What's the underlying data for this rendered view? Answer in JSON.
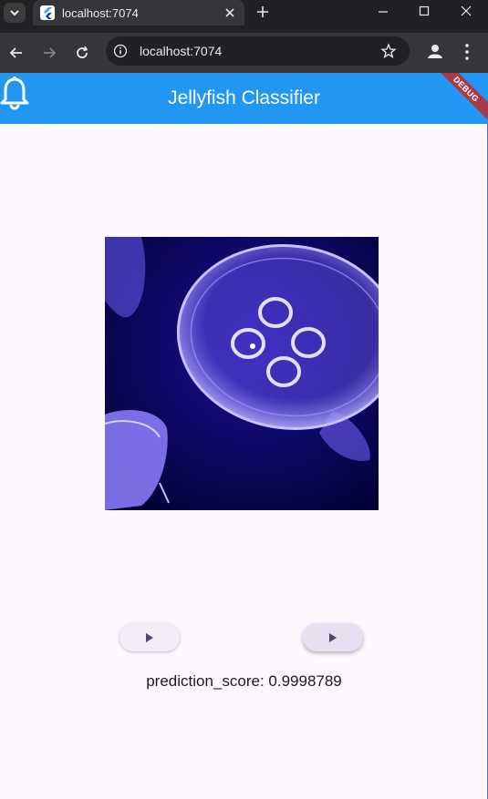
{
  "browser": {
    "tab_title": "localhost:7074",
    "url": "localhost:7074"
  },
  "app": {
    "title": "Jellyfish Classifier",
    "debug_banner": "DEBUG",
    "appbar_color": "#2196f3",
    "background_color": "#fdf7fe"
  },
  "image": {
    "alt": "jellyfish",
    "background_color": "#04034a",
    "accent_color": "#7a6bff"
  },
  "buttons": [
    {
      "icon": "play-arrow-icon"
    },
    {
      "icon": "play-arrow-icon"
    }
  ],
  "prediction": {
    "label": "prediction_score: 0.9998789"
  }
}
